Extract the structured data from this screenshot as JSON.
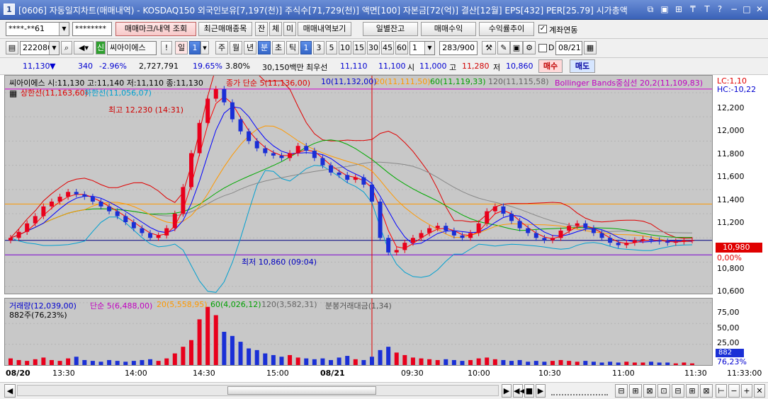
{
  "window": {
    "number": "1",
    "title": "[0606] 자동일지차트(매매내역) - KOSDAQ150 외국인보유[7,197(천)] 주식수[71,729(천)] 액면[100] 자본금[72(억)] 결산[12월] EPS[432] PER[25.79] 시가총액"
  },
  "toolbar1": {
    "account": "****-**61",
    "password": "********",
    "buttons": [
      "매매마크/내역 조회",
      "최근매매종목",
      "잔",
      "체",
      "미",
      "매매내역보기"
    ],
    "right_buttons": [
      "일별잔고",
      "매매수익",
      "수익률추이"
    ],
    "sync_label": "계좌연동"
  },
  "toolbar2": {
    "code": "222080",
    "name": "씨아이에스",
    "badge": "신",
    "period": "일",
    "period_num": "1",
    "periods": [
      "주",
      "월",
      "년",
      "분",
      "초",
      "틱"
    ],
    "minutes": [
      "1",
      "3",
      "5",
      "10",
      "15",
      "30",
      "45",
      "60"
    ],
    "count_sel": "1",
    "count": "283/900",
    "date": "08/21"
  },
  "quote": {
    "price": "11,130",
    "arrow": "▼",
    "change": "340",
    "change_pct": "-2.96%",
    "volume": "2,727,791",
    "v1": "19.65%",
    "v2": "3.80%",
    "amount": "30,150백만",
    "prio_label": "최우선",
    "prio_ask": "11,110",
    "prio_bid": "11,100",
    "open_label": "시",
    "open": "11,000",
    "high_label": "고",
    "high": "11,280",
    "low_label": "저",
    "low": "10,860",
    "buy": "매수",
    "sell": "매도"
  },
  "price_legend": {
    "ohlc": "씨아이에스 시:11,130 고:11,140 저:11,110 종:11,130",
    "ma_header": "종가 단순 5(11,136,00)",
    "ma10": "10(11,132,00)",
    "ma20": "20(11,111,50)",
    "ma60": "60(11,119,33)",
    "ma120": "120(11,115,58)",
    "bb": "Bollinger Bands중심선 20,2(11,109,83)",
    "upper": "상한선(11,163,60)",
    "lower": "하한선(11,056,07)",
    "lc": "LC:1,10",
    "hc": "HC:-10,22",
    "high_mark": "최고 12,230 (14:31)",
    "low_mark": "최저 10,860 (09:04)",
    "last_price": "10,980",
    "last_pct": "0,00%",
    "ticks": [
      "12,200",
      "12,000",
      "11,800",
      "11,600",
      "11,400",
      "11,200",
      "11,000",
      "10,800",
      "10,600"
    ]
  },
  "volume_legend": {
    "title": "거래량(12,039,00)",
    "ma5": "단순 5(6,488,00)",
    "ma20": "20(5,558,95)",
    "ma60": "60(4,026,12)",
    "ma120": "120(3,582,31)",
    "amount": "분봉거래대금(1,34)",
    "unit": "882주(76,23%)",
    "ticks": [
      "75,00",
      "50,00",
      "25,00"
    ],
    "last": "882",
    "last_pct": "76,23%"
  },
  "xaxis": {
    "labels": [
      "08/20",
      "13:30",
      "14:00",
      "14:30",
      "15:00",
      "08/21",
      "09:30",
      "10:00",
      "10:30",
      "11:00",
      "11:30"
    ],
    "time": "11:33:00"
  },
  "colors": {
    "up": "#e8001c",
    "down": "#1a2fd6",
    "ma5": "#ff0000",
    "ma10": "#0000ff",
    "ma20": "#ff9900",
    "ma60": "#00aa00",
    "ma120": "#888888",
    "bb_upper": "#e00000",
    "bb_lower": "#00a0d0",
    "bb_mid": "#c000c0",
    "hline_high": "#d000d0",
    "hline_low": "#7a00d0",
    "hline_mid": "#000080"
  },
  "chart_data": {
    "type": "candlestick",
    "ylim": [
      10540,
      12340
    ],
    "x_ticks": [
      "08/20",
      "13:30",
      "14:00",
      "14:30",
      "15:00",
      "08/21",
      "09:30",
      "10:00",
      "10:30",
      "11:00",
      "11:30"
    ],
    "hlines": [
      12230,
      10860,
      10980,
      11280
    ],
    "closes": [
      11000,
      11050,
      11120,
      11180,
      11260,
      11300,
      11340,
      11380,
      11360,
      11340,
      11300,
      11260,
      11220,
      11180,
      11130,
      11080,
      11040,
      11000,
      11020,
      11080,
      11200,
      11420,
      11700,
      11950,
      12150,
      12230,
      12120,
      11980,
      11880,
      11800,
      11740,
      11700,
      11680,
      11660,
      11700,
      11760,
      11720,
      11660,
      11600,
      11540,
      11520,
      11480,
      11500,
      11440,
      11300,
      11000,
      10880,
      10900,
      10960,
      11000,
      11040,
      11080,
      11100,
      11060,
      11020,
      11000,
      11040,
      11120,
      11220,
      11260,
      11200,
      11140,
      11080,
      11040,
      11000,
      10980,
      11000,
      11060,
      11100,
      11120,
      11080,
      11040,
      11000,
      10960,
      10940,
      10960,
      10980,
      10990,
      10980,
      10970,
      10960,
      10970,
      10980,
      10980
    ],
    "volumes": [
      8,
      6,
      5,
      7,
      9,
      6,
      5,
      8,
      10,
      6,
      5,
      4,
      6,
      5,
      4,
      5,
      6,
      7,
      5,
      8,
      14,
      22,
      30,
      55,
      70,
      60,
      40,
      35,
      28,
      20,
      18,
      14,
      12,
      10,
      12,
      9,
      8,
      7,
      8,
      6,
      9,
      11,
      7,
      6,
      10,
      18,
      22,
      15,
      12,
      9,
      8,
      7,
      6,
      7,
      6,
      5,
      6,
      8,
      9,
      7,
      6,
      5,
      6,
      4,
      5,
      4,
      5,
      6,
      5,
      4,
      5,
      4,
      3,
      4,
      3,
      4,
      3,
      3,
      4,
      3,
      3,
      2,
      3,
      2
    ]
  }
}
